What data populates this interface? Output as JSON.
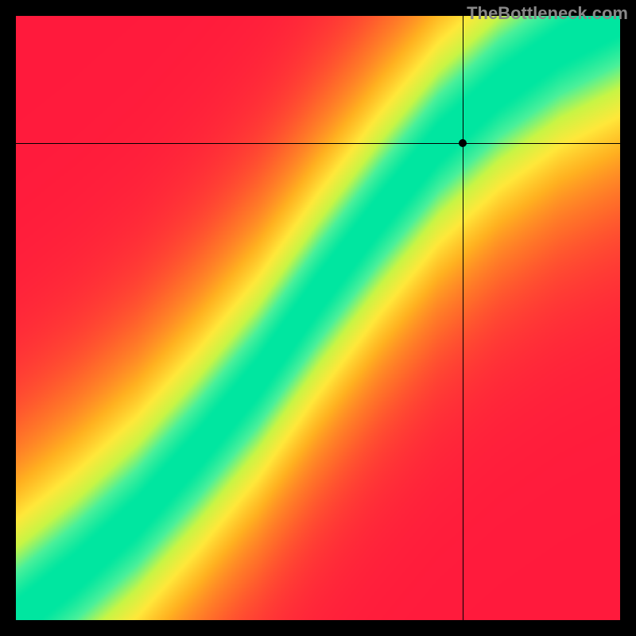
{
  "watermark": "TheBottleneck.com",
  "chart_data": {
    "type": "heatmap",
    "title": "",
    "xlabel": "",
    "ylabel": "",
    "xlim": [
      0,
      100
    ],
    "ylim": [
      0,
      100
    ],
    "crosshair": {
      "x": 74,
      "y": 79
    },
    "color_scale": [
      "#ff1a3c",
      "#ff6a2a",
      "#ffb020",
      "#ffe83a",
      "#c8f545",
      "#4af09a",
      "#00e6a0"
    ],
    "description": "Diagonal optimal-match band heatmap. Value approaches 1 (green) along a slightly super-linear diagonal curve from bottom-left to top-right and falls to 0 (red) away from it.",
    "optimal_curve_samples": [
      {
        "x": 0,
        "y": 0
      },
      {
        "x": 10,
        "y": 8
      },
      {
        "x": 20,
        "y": 17
      },
      {
        "x": 30,
        "y": 28
      },
      {
        "x": 40,
        "y": 40
      },
      {
        "x": 50,
        "y": 54
      },
      {
        "x": 60,
        "y": 67
      },
      {
        "x": 70,
        "y": 79
      },
      {
        "x": 80,
        "y": 88
      },
      {
        "x": 90,
        "y": 95
      },
      {
        "x": 100,
        "y": 100
      }
    ],
    "band_halfwidth_pct": 6
  }
}
